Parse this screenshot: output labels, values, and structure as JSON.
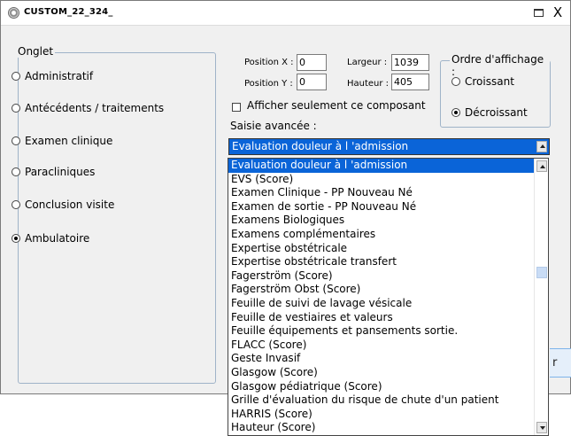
{
  "window": {
    "title": "CUSTOM_22_324_",
    "maximize_icon": "maximize-icon",
    "close_label": "X"
  },
  "onglet": {
    "legend": "Onglet",
    "options": [
      {
        "label": "Administratif",
        "checked": false
      },
      {
        "label": "Antécédents / traitements",
        "checked": false
      },
      {
        "label": "Examen clinique",
        "checked": false
      },
      {
        "label": "Paracliniques",
        "checked": false
      },
      {
        "label": "Conclusion visite",
        "checked": false
      },
      {
        "label": "Ambulatoire",
        "checked": true
      }
    ]
  },
  "position": {
    "x_label": "Position X :",
    "x_value": "0",
    "y_label": "Position Y :",
    "y_value": "0",
    "width_label": "Largeur :",
    "width_value": "1039",
    "height_label": "Hauteur :",
    "height_value": "405"
  },
  "display_order": {
    "legend": "Ordre d'affichage :",
    "ascending": "Croissant",
    "descending": "Décroissant",
    "selected": "Décroissant"
  },
  "only_component": {
    "label": "Afficher seulement ce composant",
    "checked": false
  },
  "advanced_entry": {
    "label": "Saisie avancée :",
    "selected": "Evaluation douleur à l 'admission",
    "items": [
      "Evaluation douleur à l 'admission",
      "EVS (Score)",
      "Examen Clinique - PP Nouveau Né",
      "Examen de sortie - PP Nouveau Né",
      "Examens Biologiques",
      "Examens complémentaires",
      "Expertise obstétricale",
      "Expertise obstétricale transfert",
      "Fagerström (Score)",
      "Fagerström Obst (Score)",
      "Feuille de suivi de lavage vésicale",
      "Feuille de vestiaires et valeurs",
      "Feuille équipements et pansements sortie.",
      "FLACC (Score)",
      "Geste Invasif",
      "Glasgow (Score)",
      "Glasgow pédiatrique (Score)",
      "Grille d'évaluation du risque de chute d'un patient",
      "HARRIS (Score)",
      "Hauteur (Score)"
    ]
  },
  "hidden_button_fragment": "r"
}
